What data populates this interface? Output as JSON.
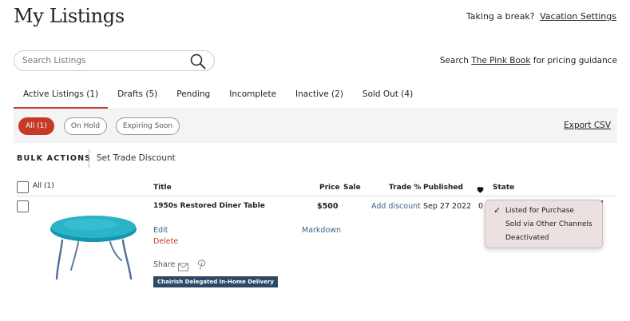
{
  "header": {
    "title": "My Listings",
    "vacation_prompt": "Taking a break?",
    "vacation_link": "Vacation Settings"
  },
  "search": {
    "placeholder": "Search Listings",
    "value": "",
    "icon": "search-icon"
  },
  "pricing": {
    "prefix": "Search ",
    "link": "The Pink Book",
    "suffix": " for pricing guidance"
  },
  "tabs": [
    {
      "label": "Active Listings (1)",
      "active": true
    },
    {
      "label": "Drafts (5)",
      "active": false
    },
    {
      "label": "Pending",
      "active": false
    },
    {
      "label": "Incomplete",
      "active": false
    },
    {
      "label": "Inactive (2)",
      "active": false
    },
    {
      "label": "Sold Out (4)",
      "active": false
    }
  ],
  "filters": {
    "pills": [
      {
        "label": "All (1)",
        "active": true
      },
      {
        "label": "On Hold",
        "active": false
      },
      {
        "label": "Expiring Soon",
        "active": false
      }
    ],
    "export_label": "Export CSV"
  },
  "bulk": {
    "label": "BULK ACTIONS",
    "set_trade": "Set Trade Discount"
  },
  "table": {
    "select_all": "All (1)",
    "columns": {
      "title": "Title",
      "price": "Price",
      "sale": "Sale",
      "trade": "Trade %",
      "published": "Published",
      "favorites_icon": "heart-icon",
      "state": "State"
    },
    "rows": [
      {
        "title": "1950s Restored Diner Table",
        "price": "$500",
        "sale": "",
        "trade": "Add discount",
        "published": "Sep 27 2022",
        "favorites": "0",
        "edit": "Edit",
        "delete": "Delete",
        "markdown": "Markdown",
        "share": "Share",
        "badge": "Chairish Delegated In-Home Delivery",
        "image_color": "#2bb3c7"
      }
    ]
  },
  "state_dropdown": {
    "options": [
      {
        "label": "Listed for Purchase",
        "selected": true
      },
      {
        "label": "Sold via Other Channels",
        "selected": false
      },
      {
        "label": "Deactivated",
        "selected": false
      }
    ]
  },
  "colors": {
    "accent": "#c73a28",
    "link_blue": "#3b5f8a",
    "badge_bg": "#2c4a63",
    "dropdown_bg": "#ebe1e1"
  }
}
